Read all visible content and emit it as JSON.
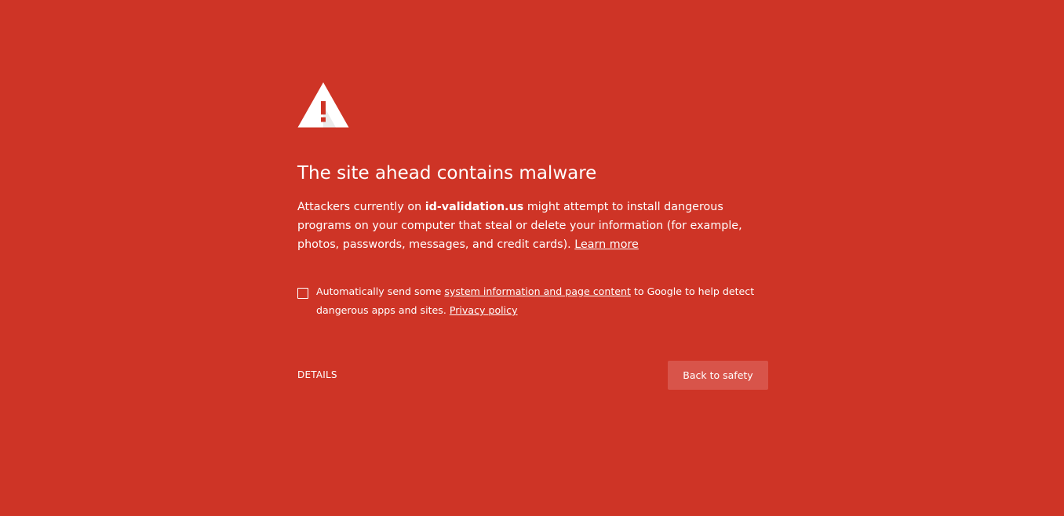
{
  "colors": {
    "background": "#ce3426",
    "button_background": "#d8544a",
    "text": "#ffffff"
  },
  "icon": "warning-triangle-icon",
  "heading": "The site ahead contains malware",
  "explanation": {
    "prefix": "Attackers currently on ",
    "domain": "id-validation.us",
    "suffix": " might attempt to install dangerous programs on your computer that steal or delete your information (for example, photos, passwords, messages, and credit cards). ",
    "learn_more": "Learn more"
  },
  "optin": {
    "checked": false,
    "prefix": "Automatically send some ",
    "link": "system information and page content",
    "middle": " to Google to help detect dangerous apps and sites. ",
    "privacy_link": "Privacy policy"
  },
  "actions": {
    "details_label": "DETAILS",
    "back_label": "Back to safety"
  }
}
